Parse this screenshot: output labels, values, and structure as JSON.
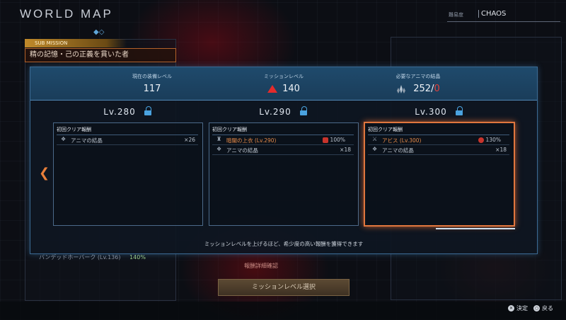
{
  "screen": {
    "title": "WORLD MAP",
    "difficulty_label": "難易度",
    "difficulty_value": "CHAOS"
  },
  "left_panel": {
    "tag": "SUB MISSION",
    "mission_title": "精の記憶・己の正義を貫いた者",
    "bottom_item_name": "バンデッドホーバーク (Lv.136)",
    "bottom_item_pct": "140%"
  },
  "modal": {
    "stats": {
      "equip_level_label": "現在の装備レベル",
      "equip_level_value": "117",
      "mission_level_label": "ミッションレベル",
      "mission_level_value": "140",
      "anima_label": "必要なアニマの結晶",
      "anima_have": "252",
      "anima_sep": "/",
      "anima_need": "0"
    },
    "columns": [
      {
        "title": "Lv.280",
        "header": "初回クリア報酬",
        "rewards": [
          {
            "name": "アニマの結晶",
            "qty": "×26"
          }
        ]
      },
      {
        "title": "Lv.290",
        "header": "初回クリア報酬",
        "rewards": [
          {
            "name": "暗闇の上衣 (Lv.290)",
            "pct": "100%"
          },
          {
            "name": "アニマの結晶",
            "qty": "×18"
          }
        ]
      },
      {
        "title": "Lv.300",
        "header": "初回クリア報酬",
        "rewards": [
          {
            "name": "アビス (Lv.300)",
            "pct": "130%"
          },
          {
            "name": "アニマの結晶",
            "qty": "×18"
          }
        ]
      }
    ],
    "footer_text": "ミッションレベルを上げるほど、希少度の高い報酬を獲得できます"
  },
  "bottom": {
    "link": "報酬詳細確認",
    "button": "ミッションレベル選択"
  },
  "footer": {
    "confirm": "決定",
    "back": "戻る"
  },
  "colors": {
    "accent_orange": "#e0763e",
    "lock_blue": "#4aa3e0",
    "danger_red": "#e52b2b"
  }
}
